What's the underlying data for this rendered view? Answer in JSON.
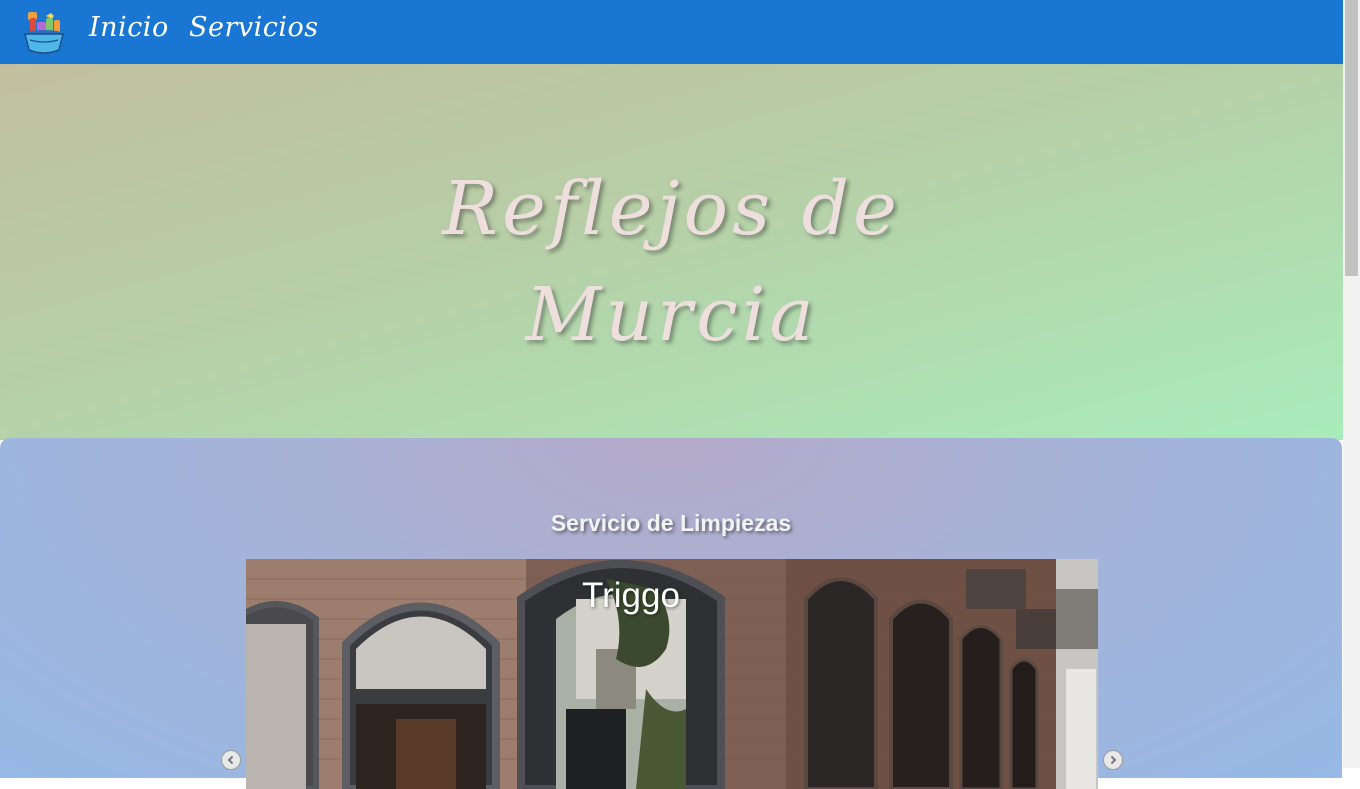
{
  "nav": {
    "logo_icon": "cleaning-supplies-bucket-icon",
    "links": [
      "Inicio",
      "Servicios"
    ]
  },
  "hero": {
    "title_line1": "Reflejos de",
    "title_line2": "Murcia"
  },
  "section": {
    "heading": "Servicio de Limpiezas"
  },
  "carousel": {
    "caption": "Triggo",
    "prev_icon": "chevron-left-icon",
    "next_icon": "chevron-right-icon"
  },
  "colors": {
    "navbar": "#1976d2",
    "hero_gradient_start": "#c1bf9f",
    "hero_gradient_end": "#a9ecbb",
    "section_gradient": "#96b9e6"
  }
}
